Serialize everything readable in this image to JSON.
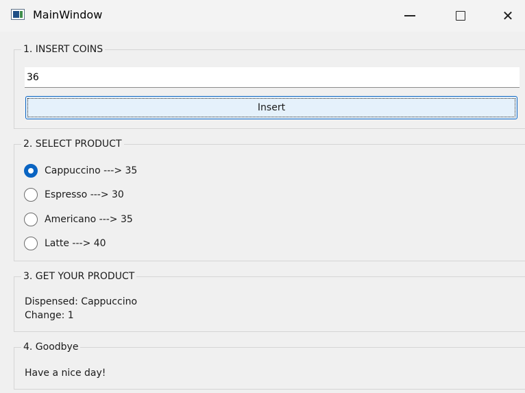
{
  "window": {
    "title": "MainWindow",
    "app_icon": "window-app-icon",
    "controls": {
      "minimize_icon": "minimize-icon",
      "maximize_icon": "maximize-icon",
      "close_glyph": "✕"
    }
  },
  "insert_coins": {
    "title": "1. INSERT COINS",
    "input_value": "36",
    "button_label": "Insert"
  },
  "select_product": {
    "title": "2. SELECT PRODUCT",
    "options": [
      {
        "label": "Cappuccino ---> 35",
        "checked": true
      },
      {
        "label": "Espresso ---> 30",
        "checked": false
      },
      {
        "label": "Americano ---> 35",
        "checked": false
      },
      {
        "label": "Latte ---> 40",
        "checked": false
      }
    ]
  },
  "get_product": {
    "title": "3. GET YOUR PRODUCT",
    "dispensed": "Dispensed: Cappuccino",
    "change": "Change: 1"
  },
  "goodbye": {
    "title": "4. Goodbye",
    "message": "Have a nice day!"
  },
  "colors": {
    "accent": "#0a64c2",
    "button_bg": "#e5f1fb",
    "window_bg": "#f0f0f0"
  }
}
